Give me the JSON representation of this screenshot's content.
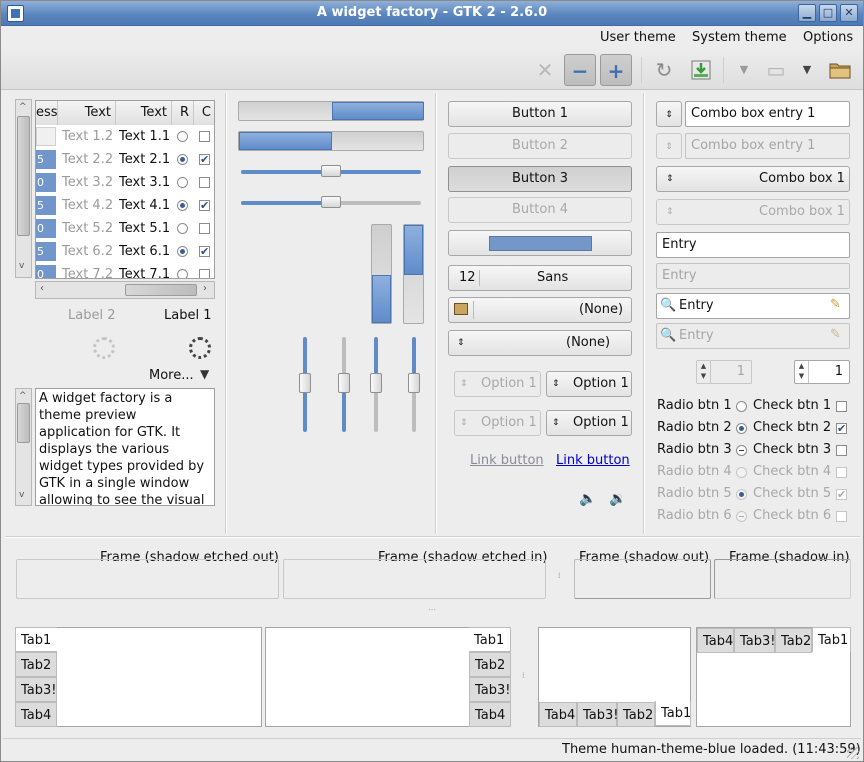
{
  "window": {
    "title": "A widget factory - GTK 2 - 2.6.0",
    "min": "▁",
    "max": "□",
    "close": "✕"
  },
  "menu": {
    "user_theme": "User theme",
    "system_theme": "System theme",
    "options": "Options"
  },
  "toolbar": {
    "icons": [
      "close-icon",
      "zoom-out-icon",
      "zoom-in-icon",
      "refresh-icon",
      "install-icon",
      "chevron-down-icon",
      "computer-icon",
      "chevron-down-icon",
      "folder-icon"
    ]
  },
  "tree": {
    "headers": [
      "ess",
      "Text",
      "Text",
      "R",
      "C"
    ],
    "rows": [
      {
        "t1": "Text 1.2",
        "t2": "Text 1.1",
        "radio": false,
        "check": false,
        "prog": ""
      },
      {
        "t1": "Text 2.2",
        "t2": "Text 2.1",
        "radio": true,
        "check": true,
        "prog": "5"
      },
      {
        "t1": "Text 3.2",
        "t2": "Text 3.1",
        "radio": false,
        "check": false,
        "prog": "0"
      },
      {
        "t1": "Text 4.2",
        "t2": "Text 4.1",
        "radio": true,
        "check": true,
        "prog": "5"
      },
      {
        "t1": "Text 5.2",
        "t2": "Text 5.1",
        "radio": false,
        "check": false,
        "prog": "0"
      },
      {
        "t1": "Text 6.2",
        "t2": "Text 6.1",
        "radio": true,
        "check": true,
        "prog": "5"
      },
      {
        "t1": "Text 7.2",
        "t2": "Text 7.1",
        "radio": false,
        "check": false,
        "prog": "0"
      }
    ]
  },
  "labels": {
    "label2": "Label 2",
    "label1": "Label 1",
    "more": "More...",
    "text": "A widget factory is a theme preview application for GTK. It displays the various widget types provided by GTK in a single window allowing to see the visual effect of the applied"
  },
  "progress": {
    "h1": 0.5,
    "h2": 0.5,
    "v1": 0.5,
    "v2": 0.5
  },
  "sliders": {
    "h1": 0.5,
    "h2": 0.5,
    "v_levels": [
      0.5,
      0.5,
      0.5,
      0.5
    ]
  },
  "buttons": {
    "b1": "Button 1",
    "b2": "Button 2",
    "b3": "Button 3",
    "b4": "Button 4",
    "font_size": "12",
    "font_name": "Sans",
    "file1": "(None)",
    "file2": "(None)",
    "opt1": "Option 1",
    "opt2": "Option 1",
    "opt3": "Option 1",
    "opt4": "Option 1",
    "link1": "Link button",
    "link2": "Link button"
  },
  "combo": {
    "entry1": "Combo box entry 1",
    "entry2": "Combo box entry 1",
    "box1": "Combo box 1",
    "box2": "Combo box 1",
    "entry": "Entry",
    "entry_dis": "Entry",
    "search": "Entry",
    "search_dis": "Entry",
    "spin1": "1",
    "spin2": "1"
  },
  "radios": [
    {
      "label": "Radio btn 1",
      "state": "off",
      "check": "Check btn 1",
      "cstate": "off",
      "dis": false
    },
    {
      "label": "Radio btn 2",
      "state": "on",
      "check": "Check btn 2",
      "cstate": "on",
      "dis": false
    },
    {
      "label": "Radio btn 3",
      "state": "mixed",
      "check": "Check btn 3",
      "cstate": "off",
      "dis": false
    },
    {
      "label": "Radio btn 4",
      "state": "off",
      "check": "Check btn 4",
      "cstate": "off",
      "dis": true
    },
    {
      "label": "Radio btn 5",
      "state": "on",
      "check": "Check btn 5",
      "cstate": "on",
      "dis": true
    },
    {
      "label": "Radio btn 6",
      "state": "mixed",
      "check": "Check btn 6",
      "cstate": "off",
      "dis": true
    }
  ],
  "frames": {
    "f1": "Frame (shadow etched out)",
    "f2": "Frame (shadow etched in)",
    "f3": "Frame (shadow out)",
    "f4": "Frame (shadow in)"
  },
  "tabs": {
    "t1": "Tab1",
    "t2": "Tab2",
    "t3": "Tab3!",
    "t4": "Tab4"
  },
  "status": "Theme human-theme-blue loaded.  (11:43:59)"
}
